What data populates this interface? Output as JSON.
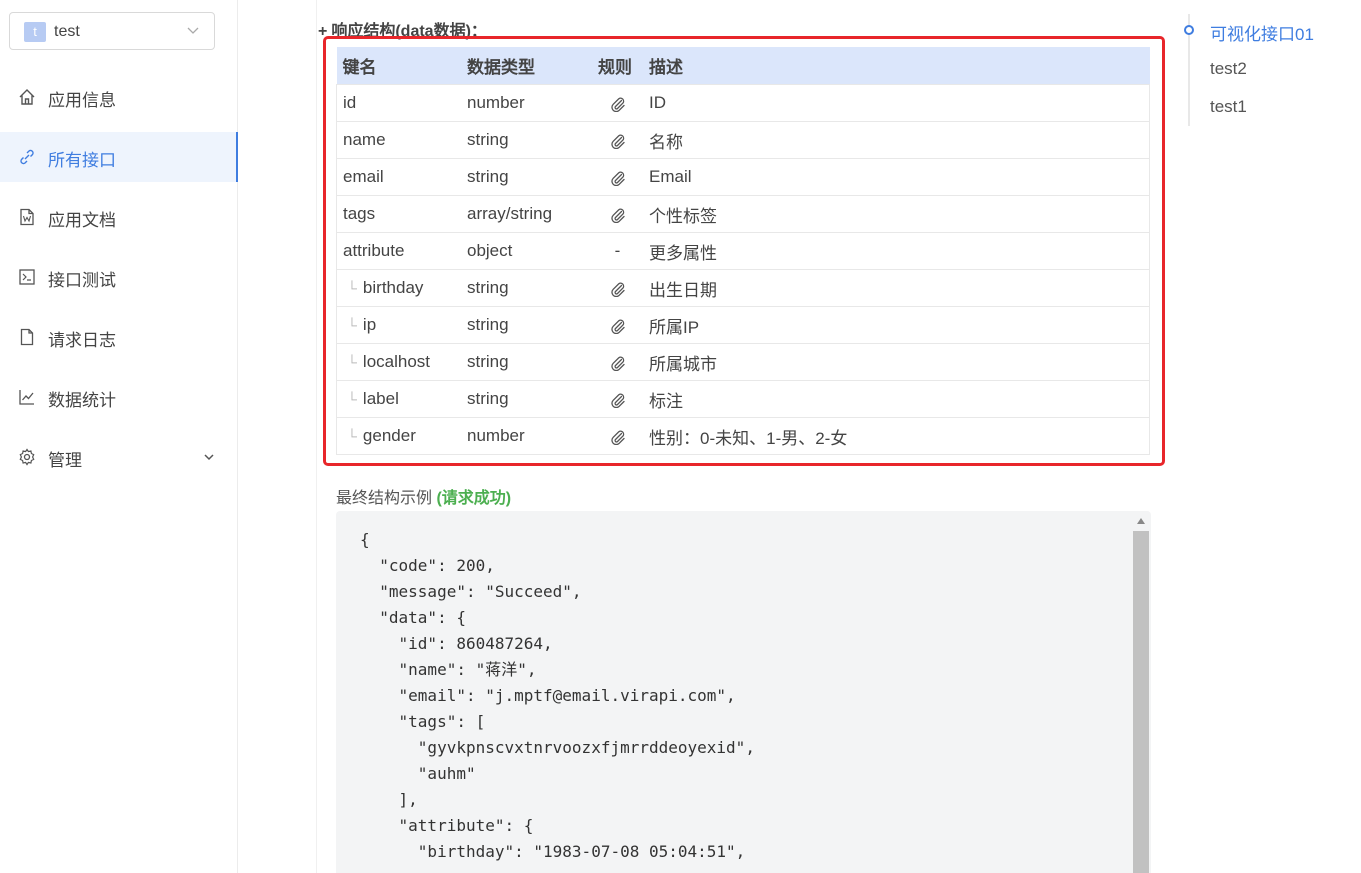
{
  "app": {
    "avatar_letter": "t",
    "name": "test"
  },
  "menu": [
    {
      "label": "应用信息",
      "icon": "home-icon",
      "active": false
    },
    {
      "label": "所有接口",
      "icon": "link-icon",
      "active": true
    },
    {
      "label": "应用文档",
      "icon": "document-icon",
      "active": false
    },
    {
      "label": "接口测试",
      "icon": "terminal-icon",
      "active": false
    },
    {
      "label": "请求日志",
      "icon": "file-icon",
      "active": false
    },
    {
      "label": "数据统计",
      "icon": "chart-icon",
      "active": false
    },
    {
      "label": "管理",
      "icon": "gear-icon",
      "active": false
    }
  ],
  "section": {
    "title": "响应结构(data数据)："
  },
  "table": {
    "headers": [
      "键名",
      "数据类型",
      "规则",
      "描述"
    ],
    "rows": [
      {
        "key": "id",
        "type": "number",
        "rule": "clip",
        "desc": "ID",
        "child": false
      },
      {
        "key": "name",
        "type": "string",
        "rule": "clip",
        "desc": "名称",
        "child": false
      },
      {
        "key": "email",
        "type": "string",
        "rule": "clip",
        "desc": "Email",
        "child": false
      },
      {
        "key": "tags",
        "type": "array/string",
        "rule": "clip",
        "desc": "个性标签",
        "child": false
      },
      {
        "key": "attribute",
        "type": "object",
        "rule": "-",
        "desc": "更多属性",
        "child": false
      },
      {
        "key": "birthday",
        "type": "string",
        "rule": "clip",
        "desc": "出生日期",
        "child": true
      },
      {
        "key": "ip",
        "type": "string",
        "rule": "clip",
        "desc": "所属IP",
        "child": true
      },
      {
        "key": "localhost",
        "type": "string",
        "rule": "clip",
        "desc": "所属城市",
        "child": true
      },
      {
        "key": "label",
        "type": "string",
        "rule": "clip",
        "desc": "标注",
        "child": true
      },
      {
        "key": "gender",
        "type": "number",
        "rule": "clip",
        "desc": "性别：0-未知、1-男、2-女",
        "child": true
      }
    ]
  },
  "example": {
    "title": "最终结构示例",
    "status": "(请求成功)",
    "code": "{\n  \"code\": 200,\n  \"message\": \"Succeed\",\n  \"data\": {\n    \"id\": 860487264,\n    \"name\": \"蒋洋\",\n    \"email\": \"j.mptf@email.virapi.com\",\n    \"tags\": [\n      \"gyvkpnscvxtnrvoozxfjmrrddeoyexid\",\n      \"auhm\"\n    ],\n    \"attribute\": {\n      \"birthday\": \"1983-07-08 05:04:51\","
  },
  "anchors": [
    {
      "label": "可视化接口01",
      "active": true
    },
    {
      "label": "test2",
      "active": false
    },
    {
      "label": "test1",
      "active": false
    }
  ],
  "colors": {
    "accent": "#3f7de0",
    "highlight": "#e8262a",
    "success": "#4caf50",
    "table_header": "#dbe6fb"
  }
}
